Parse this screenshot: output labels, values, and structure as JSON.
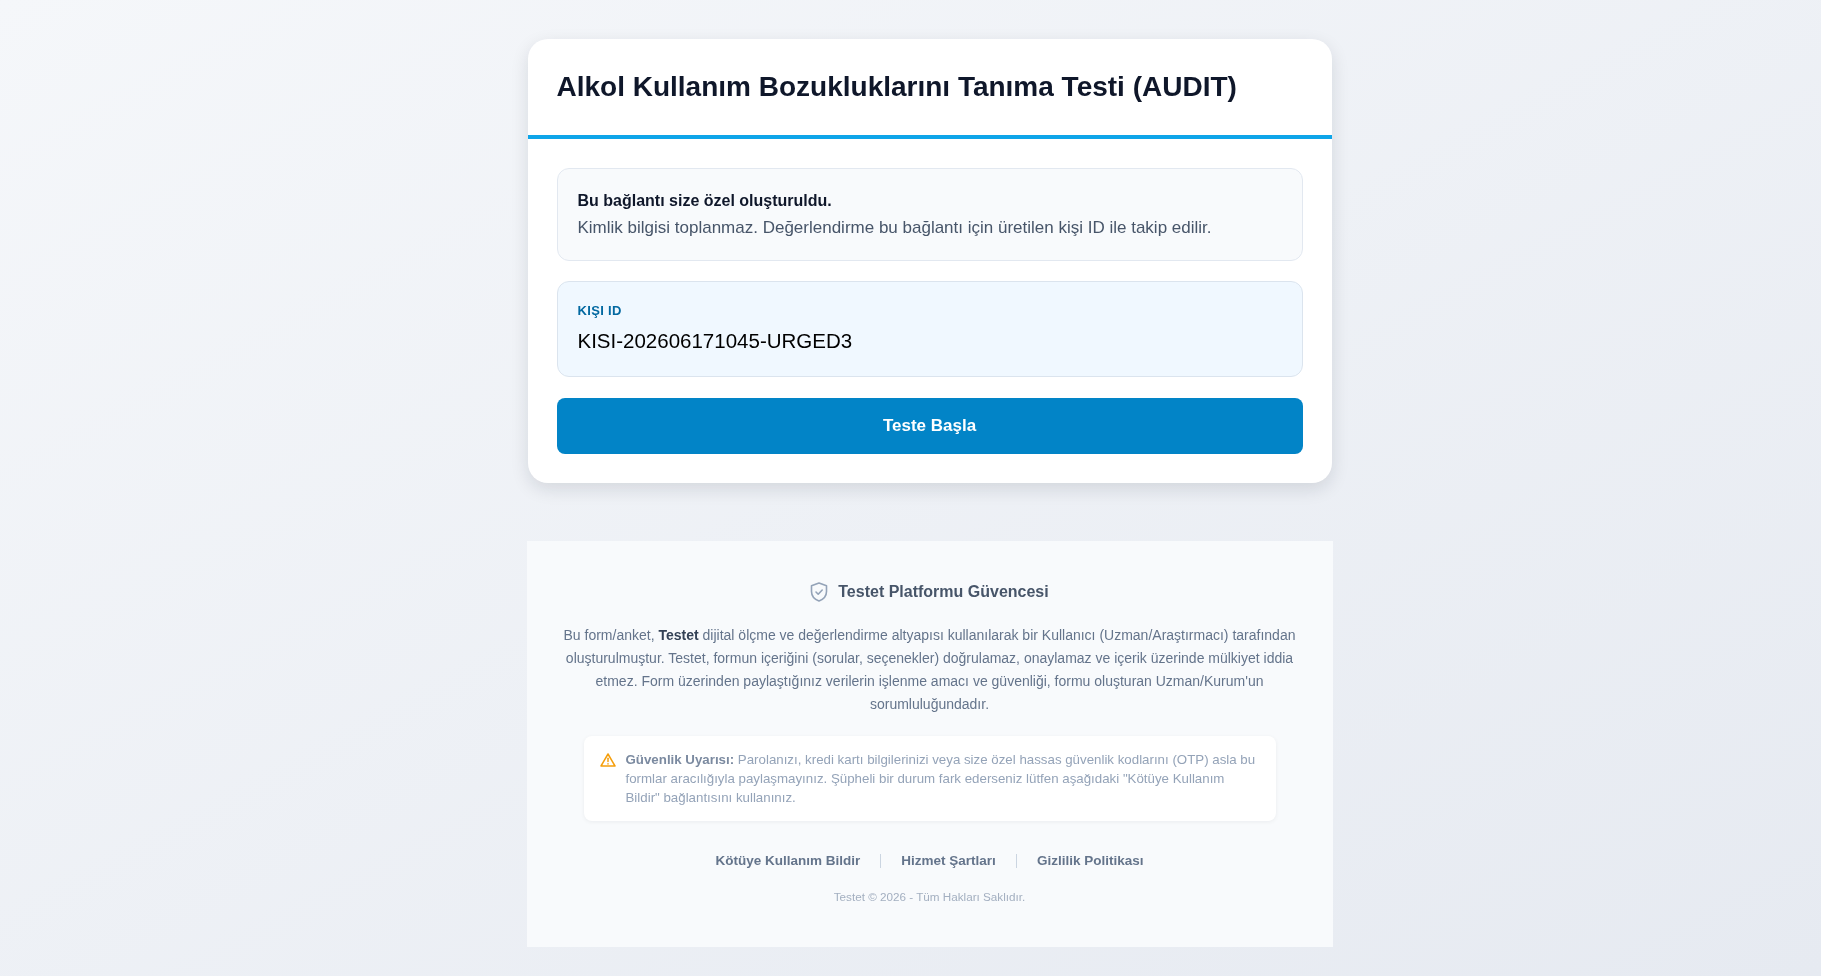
{
  "card": {
    "title": "Alkol Kullanım Bozukluklarını Tanıma Testi (AUDIT)",
    "notice": {
      "heading": "Bu bağlantı size özel oluşturuldu.",
      "text": "Kimlik bilgisi toplanmaz. Değerlendirme bu bağlantı için üretilen kişi ID ile takip edilir."
    },
    "id_panel": {
      "label": "KIŞI ID",
      "value": "KISI-202606171045-URGED3"
    },
    "start_button": "Teste Başla"
  },
  "footer": {
    "heading": "Testet Platformu Güvencesi",
    "paragraph": "Bu form/anket, **Testet** dijital ölçme ve değerlendirme altyapısı kullanılarak bir Kullanıcı (Uzman/Araştırmacı) tarafından oluşturulmuştur. Testet, formun içeriğini (sorular, seçenekler) doğrulamaz, onaylamaz ve içerik üzerinde mülkiyet iddia etmez. Form üzerinden paylaştığınız verilerin işlenme amacı ve güvenliği, formu oluşturan Uzman/Kurum'un sorumluluğundadır.",
    "warning": "**Güvenlik Uyarısı:** Parolanızı, kredi kartı bilgilerinizi veya size özel hassas güvenlik kodlarını (OTP) asla bu formlar aracılığıyla paylaşmayınız. Şüpheli bir durum fark ederseniz lütfen aşağıdaki \"Kötüye Kullanım Bildir\" bağlantısını kullanınız.",
    "links": [
      "Kötüye Kullanım Bildir",
      "Hizmet Şartları",
      "Gizlilik Politikası"
    ],
    "copyright": "Testet © 2026 - Tüm Hakları Saklıdır."
  }
}
